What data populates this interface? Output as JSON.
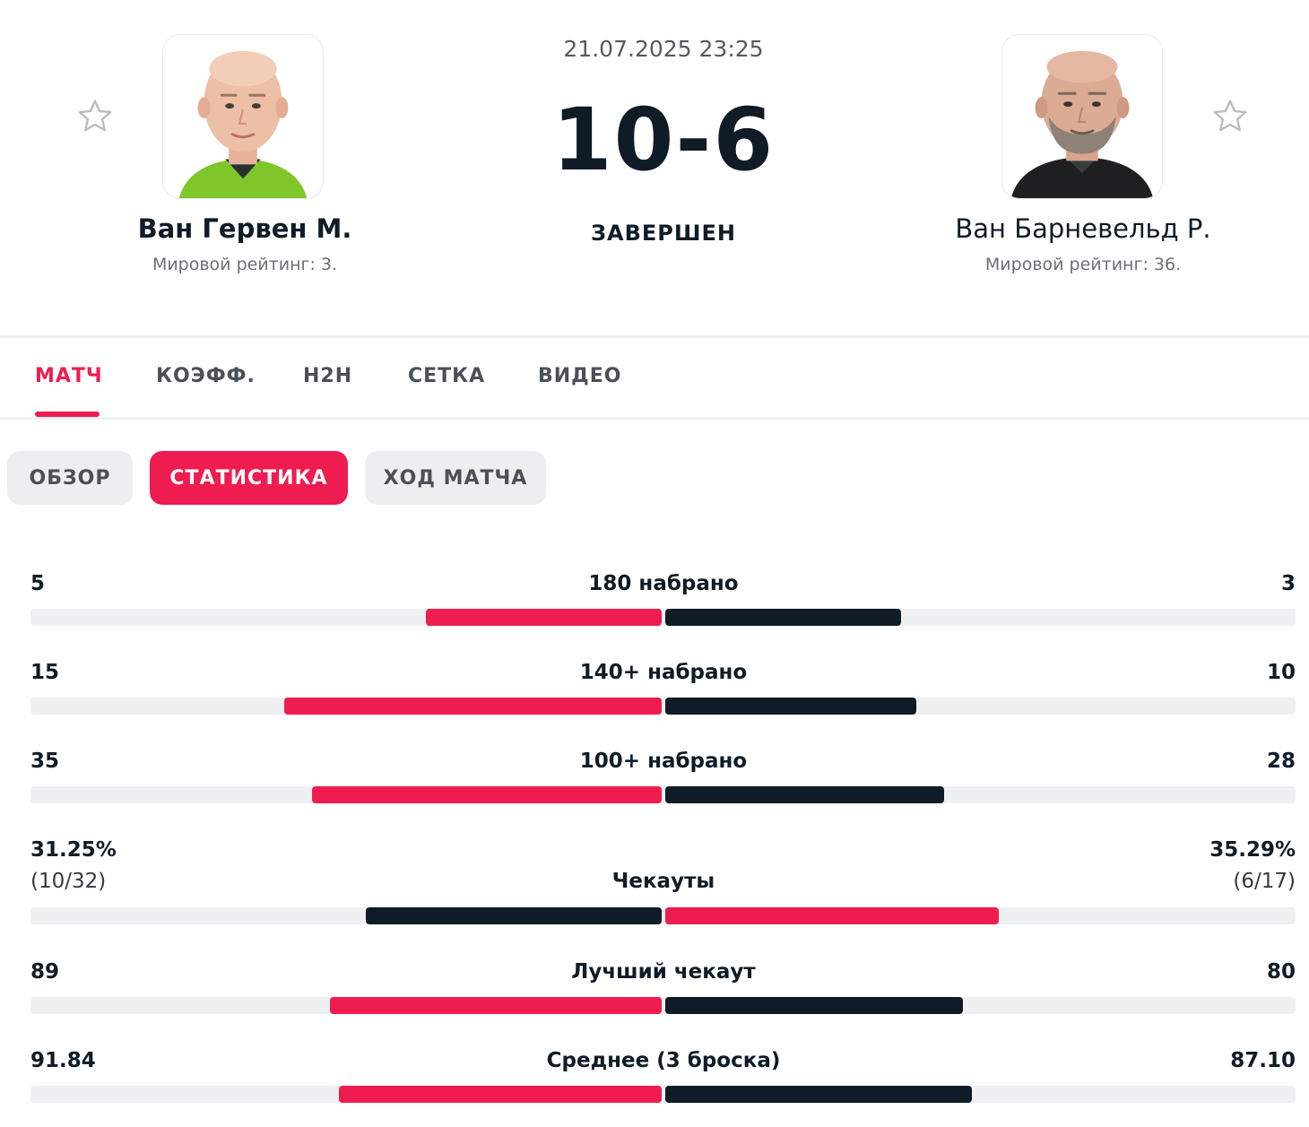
{
  "match": {
    "datetime": "21.07.2025 23:25",
    "score": "10-6",
    "status": "ЗАВЕРШЕН"
  },
  "player_left": {
    "name": "Ван Гервен М.",
    "ranking": "Мировой рейтинг: 3.",
    "favorite_icon": "star-outline-icon",
    "avatar": "player-photo-green-shirt"
  },
  "player_right": {
    "name": "Ван Барневельд Р.",
    "ranking": "Мировой рейтинг: 36.",
    "favorite_icon": "star-outline-icon",
    "avatar": "player-photo-black-shirt"
  },
  "tabs": [
    {
      "label": "МАТЧ",
      "active": true
    },
    {
      "label": "КОЭФФ.",
      "active": false
    },
    {
      "label": "H2H",
      "active": false
    },
    {
      "label": "СЕТКА",
      "active": false
    },
    {
      "label": "ВИДЕО",
      "active": false
    }
  ],
  "subtabs": [
    {
      "label": "ОБЗОР",
      "active": false
    },
    {
      "label": "СТАТИСТИКА",
      "active": true
    },
    {
      "label": "ХОД МАТЧА",
      "active": false
    }
  ],
  "colors": {
    "accent": "#ef1c4f",
    "dark": "#0f1b26",
    "track": "#eff0f1"
  },
  "stats": [
    {
      "label": "180 набрано",
      "left": "5",
      "right": "3",
      "left_sub": "",
      "right_sub": "",
      "left_share": 0.375,
      "right_share": 0.375,
      "left_color": "#ef1c4f",
      "right_color": "#0f1b26"
    },
    {
      "label": "140+ набрано",
      "left": "15",
      "right": "10",
      "left_sub": "",
      "right_sub": "",
      "left_share": 0.6,
      "right_share": 0.4,
      "left_color": "#ef1c4f",
      "right_color": "#0f1b26"
    },
    {
      "label": "100+ набрано",
      "left": "35",
      "right": "28",
      "left_sub": "",
      "right_sub": "",
      "left_share": 0.556,
      "right_share": 0.444,
      "left_color": "#ef1c4f",
      "right_color": "#0f1b26"
    },
    {
      "label": "Чекауты",
      "left": "31.25%",
      "right": "35.29%",
      "left_sub": "(10/32)",
      "right_sub": "(6/17)",
      "left_share": 0.47,
      "right_share": 0.53,
      "left_color": "#0f1b26",
      "right_color": "#ef1c4f"
    },
    {
      "label": "Лучший чекаут",
      "left": "89",
      "right": "80",
      "left_sub": "",
      "right_sub": "",
      "left_share": 0.527,
      "right_share": 0.473,
      "left_color": "#ef1c4f",
      "right_color": "#0f1b26"
    },
    {
      "label": "Среднее (3 броска)",
      "left": "91.84",
      "right": "87.10",
      "left_sub": "",
      "right_sub": "",
      "left_share": 0.513,
      "right_share": 0.487,
      "left_color": "#ef1c4f",
      "right_color": "#0f1b26"
    }
  ]
}
